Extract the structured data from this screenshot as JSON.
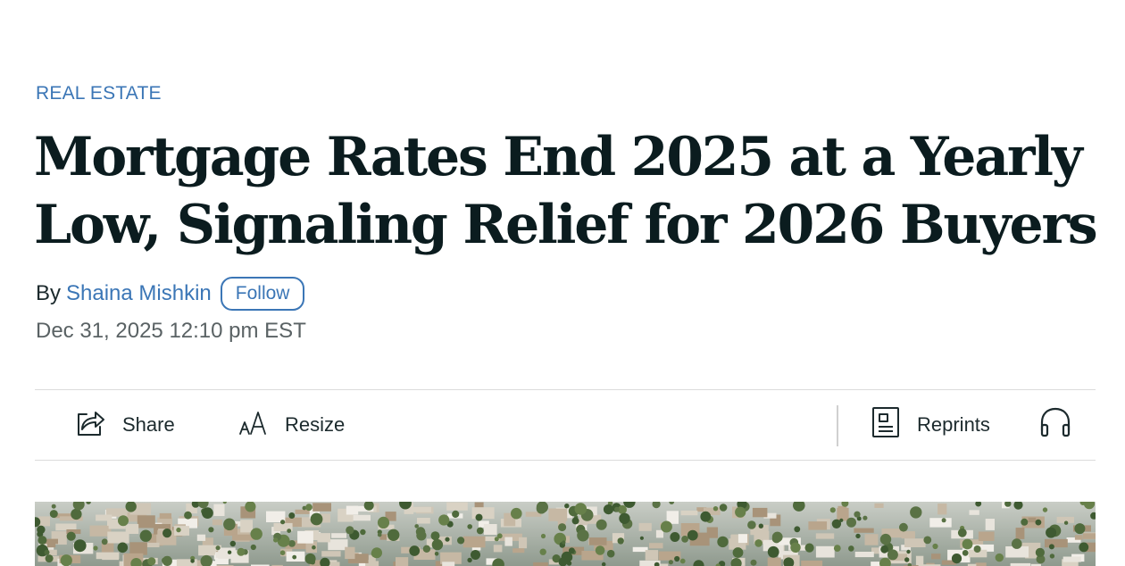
{
  "article": {
    "category": "REAL ESTATE",
    "headline": "Mortgage Rates End 2025 at a Yearly Low, Signaling Relief for 2026 Buyers",
    "byline_prefix": "By",
    "author": "Shaina Mishkin",
    "follow_label": "Follow",
    "timestamp": "Dec 31, 2025 12:10 pm EST"
  },
  "toolbar": {
    "share_label": "Share",
    "resize_label": "Resize",
    "reprints_label": "Reprints",
    "icons": {
      "share": "share-icon",
      "resize": "text-resize-icon",
      "reprints": "reprints-icon",
      "listen": "headphones-icon"
    }
  },
  "hero": {
    "description_icon": "aerial-neighborhood-photo"
  },
  "colors": {
    "accent": "#3b76b6",
    "text": "#0b1c1f",
    "muted": "#5a6264",
    "divider": "#dcdcdc"
  }
}
